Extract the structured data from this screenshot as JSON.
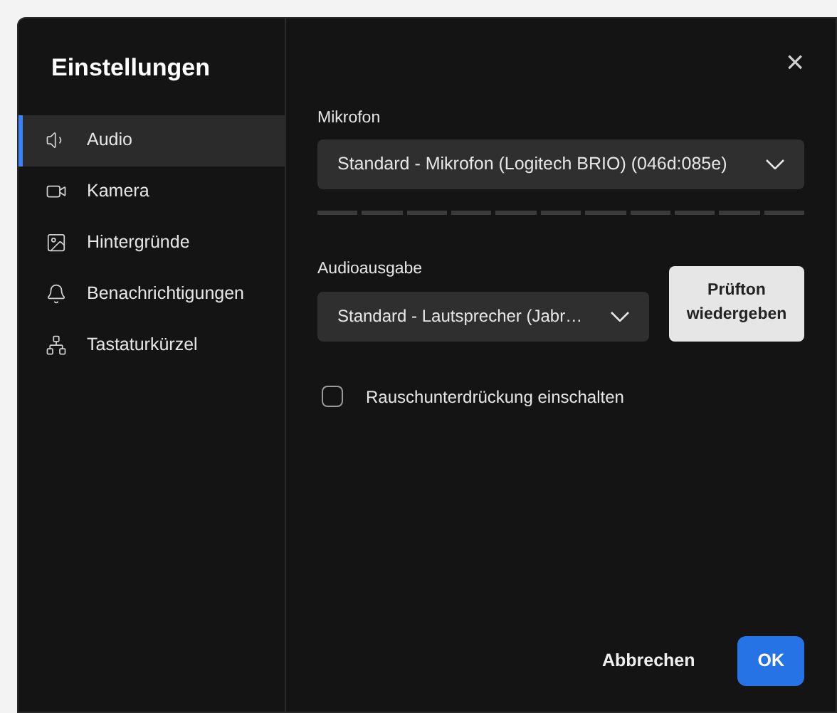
{
  "dialog": {
    "title": "Einstellungen",
    "close": "×"
  },
  "sidebar": {
    "items": [
      {
        "label": "Audio",
        "selected": true
      },
      {
        "label": "Kamera",
        "selected": false
      },
      {
        "label": "Hintergründe",
        "selected": false
      },
      {
        "label": "Benachrichtigungen",
        "selected": false
      },
      {
        "label": "Tastaturkürzel",
        "selected": false
      }
    ]
  },
  "microphone": {
    "label": "Mikrofon",
    "value": "Standard - Mikrofon (Logitech BRIO) (046d:085e)"
  },
  "output": {
    "label": "Audioausgabe",
    "value": "Standard - Lautsprecher (Jabr…",
    "test_button": "Prüfton wiedergeben"
  },
  "noise_suppression": {
    "label": "Rauschunterdrückung einschalten",
    "checked": false
  },
  "buttons": [
    {
      "label": "Abbrechen",
      "kind": "secondary"
    },
    {
      "label": "OK",
      "kind": "primary"
    }
  ]
}
